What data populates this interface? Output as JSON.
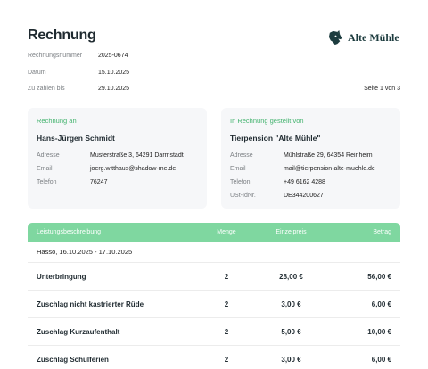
{
  "document": {
    "title": "Rechnung",
    "meta": [
      {
        "label": "Rechnungsnummer",
        "value": "2025-0674"
      },
      {
        "label": "Datum",
        "value": "15.10.2025"
      },
      {
        "label": "Zu zahlen bis",
        "value": "29.10.2025"
      }
    ],
    "page": "Seite 1 von 3"
  },
  "logo": {
    "text": "Alte Mühle",
    "icon": "dog-head-icon",
    "color": "#1d3c3f"
  },
  "billed_to": {
    "heading": "Rechnung an",
    "name": "Hans-Jürgen Schmidt",
    "rows": [
      {
        "label": "Adresse",
        "value": "Musterstraße 3, 64291 Darmstadt"
      },
      {
        "label": "Email",
        "value": "joerg.witthaus@shadow-me.de"
      },
      {
        "label": "Telefon",
        "value": "76247"
      }
    ]
  },
  "billed_by": {
    "heading": "In Rechnung gestellt von",
    "name": "Tierpension \"Alte Mühle\"",
    "rows": [
      {
        "label": "Adresse",
        "value": "Mühlstraße 29, 64354 Reinheim"
      },
      {
        "label": "Email",
        "value": "mail@tierpension-alte-muehle.de"
      },
      {
        "label": "Telefon",
        "value": "+49 6162 4288"
      },
      {
        "label": "USt-IdNr.",
        "value": "DE344200627"
      }
    ]
  },
  "table": {
    "headers": {
      "description": "Leistungsbeschreibung",
      "quantity": "Menge",
      "unit_price": "Einzelpreis",
      "amount": "Betrag"
    },
    "header_color": "#7fd7a0",
    "period": "Hasso, 16.10.2025 - 17.10.2025",
    "rows": [
      {
        "description": "Unterbringung",
        "quantity": "2",
        "unit_price": "28,00 €",
        "amount": "56,00 €"
      },
      {
        "description": "Zuschlag nicht kastrierter Rüde",
        "quantity": "2",
        "unit_price": "3,00 €",
        "amount": "6,00 €"
      },
      {
        "description": "Zuschlag Kurzaufenthalt",
        "quantity": "2",
        "unit_price": "5,00 €",
        "amount": "10,00 €"
      },
      {
        "description": "Zuschlag Schulferien",
        "quantity": "2",
        "unit_price": "3,00 €",
        "amount": "6,00 €"
      }
    ]
  },
  "accent_color": "#43b36e"
}
